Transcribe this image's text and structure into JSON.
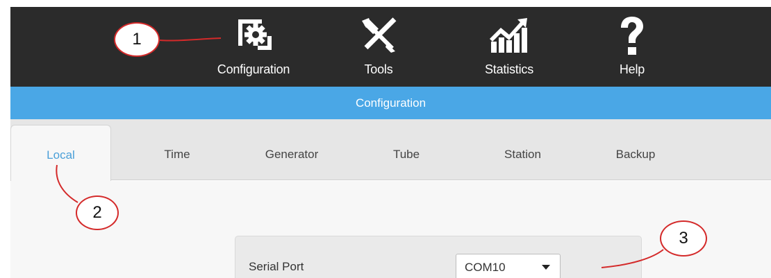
{
  "toolbar": {
    "items": [
      {
        "label": "Configuration",
        "icon": "config-gear-icon"
      },
      {
        "label": "Tools",
        "icon": "tools-icon"
      },
      {
        "label": "Statistics",
        "icon": "statistics-chart-icon"
      },
      {
        "label": "Help",
        "icon": "help-question-icon"
      }
    ]
  },
  "titlebar": {
    "title": "Configuration"
  },
  "tabs": [
    {
      "label": "Local",
      "active": true
    },
    {
      "label": "Time"
    },
    {
      "label": "Generator"
    },
    {
      "label": "Tube"
    },
    {
      "label": "Station"
    },
    {
      "label": "Backup"
    }
  ],
  "form": {
    "serial_port_label": "Serial Port",
    "serial_port_value": "COM10"
  },
  "annotations": {
    "callout_1": "1",
    "callout_2": "2",
    "callout_3": "3"
  },
  "colors": {
    "toolbar_bg": "#2b2b2b",
    "titlebar_bg": "#4aa7e6",
    "active_tab_text": "#4a9fd8",
    "annotation_red": "#d42a2a"
  }
}
